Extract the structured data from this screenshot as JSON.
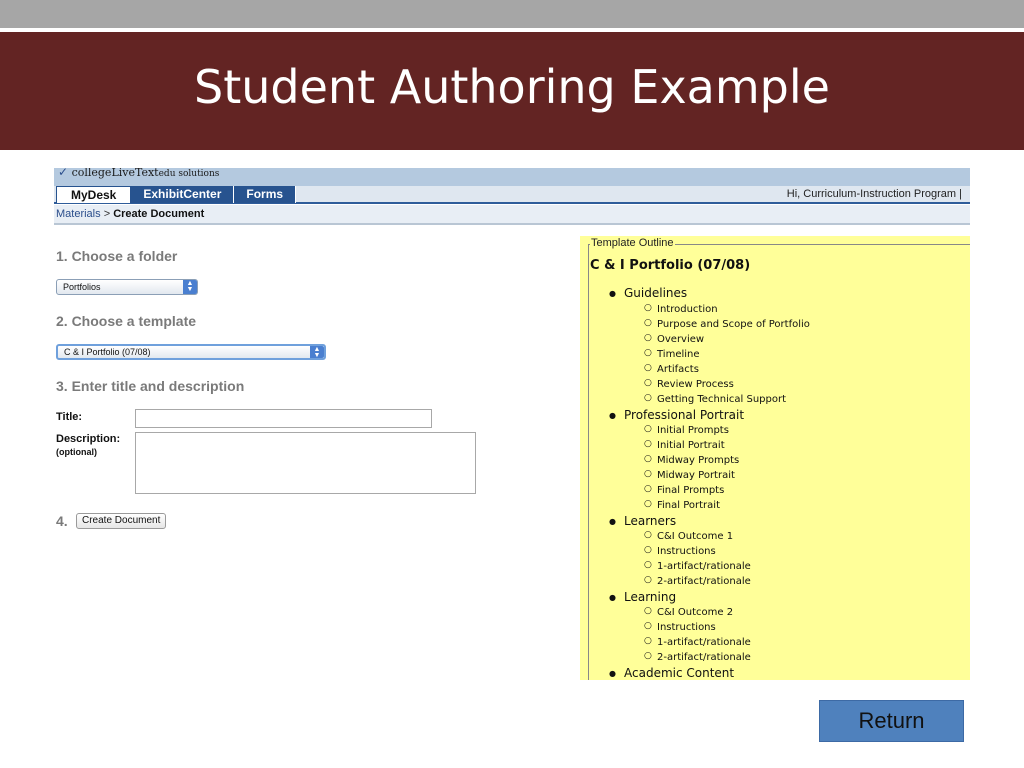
{
  "slide": {
    "title": "Student Authoring Example",
    "return_label": "Return",
    "colors": {
      "title_band": "#632423",
      "return_button": "#4f81bd",
      "outline_panel": "#ffff99"
    }
  },
  "app": {
    "logo_text": "collegeLiveText",
    "logo_suffix": "edu solutions",
    "nav_tabs": [
      "MyDesk",
      "ExhibitCenter",
      "Forms"
    ],
    "active_tab": "MyDesk",
    "greeting": "Hi, Curriculum-Instruction Program  |"
  },
  "breadcrumb": {
    "link": "Materials",
    "separator": ">",
    "current": "Create Document"
  },
  "form": {
    "step1": "1. Choose a folder",
    "folder_value": "Portfolios",
    "step2": "2. Choose a template",
    "template_value": "C & I Portfolio (07/08)",
    "step3": "3. Enter title and description",
    "title_label": "Title:",
    "title_value": "",
    "description_label": "Description:",
    "description_sub": "(optional)",
    "description_value": "",
    "step4": "4.",
    "create_button": "Create Document"
  },
  "outline": {
    "legend": "Template Outline",
    "title": "C & I Portfolio (07/08)",
    "sections": [
      {
        "label": "Guidelines",
        "items": [
          "Introduction",
          "Purpose and Scope of Portfolio",
          "Overview",
          "Timeline",
          "Artifacts",
          "Review Process",
          "Getting Technical Support"
        ]
      },
      {
        "label": "Professional Portrait",
        "items": [
          "Initial Prompts",
          "Initial Portrait",
          "Midway Prompts",
          "Midway Portrait",
          "Final Prompts",
          "Final Portrait"
        ]
      },
      {
        "label": "Learners",
        "items": [
          "C&I Outcome 1",
          "Instructions",
          "1-artifact/rationale",
          "2-artifact/rationale"
        ]
      },
      {
        "label": "Learning",
        "items": [
          "C&I Outcome 2",
          "Instructions",
          "1-artifact/rationale",
          "2-artifact/rationale"
        ]
      },
      {
        "label": "Academic Content",
        "items": []
      }
    ]
  }
}
